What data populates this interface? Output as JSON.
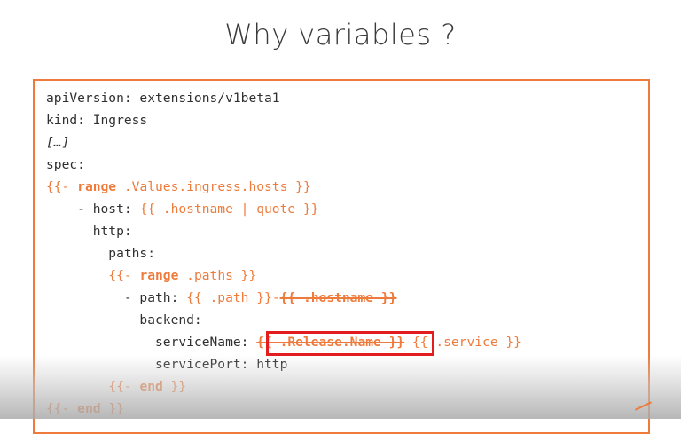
{
  "slide": {
    "title": "Why variables ?"
  },
  "colors": {
    "accent": "#ee7b3c",
    "highlight_border": "#e21d1d",
    "text": "#303030"
  },
  "code": {
    "l1": "apiVersion: extensions/v1beta1",
    "l2": "kind: Ingress",
    "l3": "[…]",
    "l4": "spec:",
    "l5_a": "{{- ",
    "l5_b": "range",
    "l5_c": " .Values.ingress.hosts }}",
    "l6_a": "    - host: ",
    "l6_b": "{{ .hostname | quote }}",
    "l7": "      http:",
    "l8": "        paths:",
    "l9_indent": "        ",
    "l9_a": "{{- ",
    "l9_b": "range",
    "l9_c": " .paths }}",
    "l10_a": "          - path: ",
    "l10_b": "{{ .path }}",
    "l10_c": "-",
    "l10_d": "{{ .hostname }}",
    "l11": "            backend:",
    "l12_a": "              serviceName: ",
    "l12_b": "{{ .Release.Name }}",
    "l12_c": " {{ .service }}",
    "l13": "              servicePort: http",
    "l14_indent": "        ",
    "l14_a": "{{- ",
    "l14_b": "end",
    "l14_c": " }}",
    "l15_a": "{{- ",
    "l15_b": "end",
    "l15_c": " }}"
  }
}
